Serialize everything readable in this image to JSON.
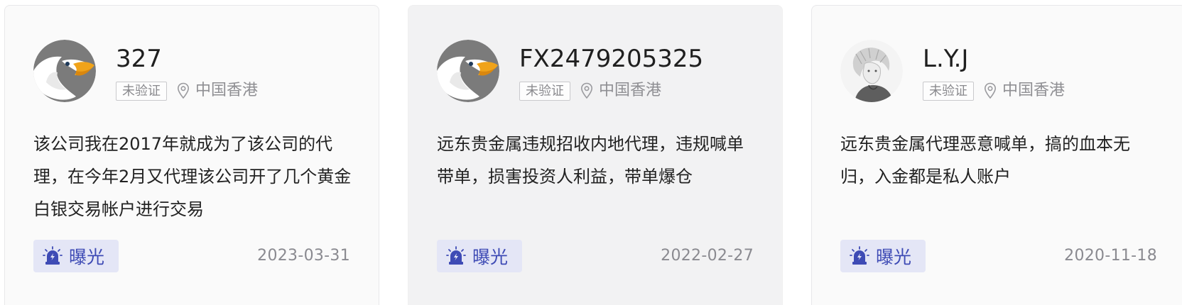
{
  "cards": [
    {
      "avatar": "eagle-avatar",
      "username": "327",
      "badge": "未验证",
      "location_icon": "map-pin-icon",
      "location": "中国香港",
      "description": "该公司我在2017年就成为了该公司的代理，在今年2月又代理该公司开了几个黄金白银交易帐户进行交易",
      "tag_icon": "alarm-light-icon",
      "tag": "曝光",
      "date": "2023-03-31"
    },
    {
      "avatar": "eagle-avatar",
      "username": "FX2479205325",
      "badge": "未验证",
      "location_icon": "map-pin-icon",
      "location": "中国香港",
      "description": "远东贵金属违规招收内地代理，违规喊单带单，损害投资人利益，带单爆仓",
      "tag_icon": "alarm-light-icon",
      "tag": "曝光",
      "date": "2022-02-27"
    },
    {
      "avatar": "sketch-portrait-avatar",
      "username": "L.Y.J",
      "badge": "未验证",
      "location_icon": "map-pin-icon",
      "location": "中国香港",
      "description": "远东贵金属代理恶意喊单，搞的血本无归，入金都是私人账户",
      "tag_icon": "alarm-light-icon",
      "tag": "曝光",
      "date": "2020-11-18"
    }
  ],
  "colors": {
    "card_bg": "#fafafa",
    "card_hover_bg": "#f2f2f3",
    "tag_bg": "#e4e6f6",
    "tag_text": "#3e4bb5",
    "muted_text": "#8a8a90"
  }
}
